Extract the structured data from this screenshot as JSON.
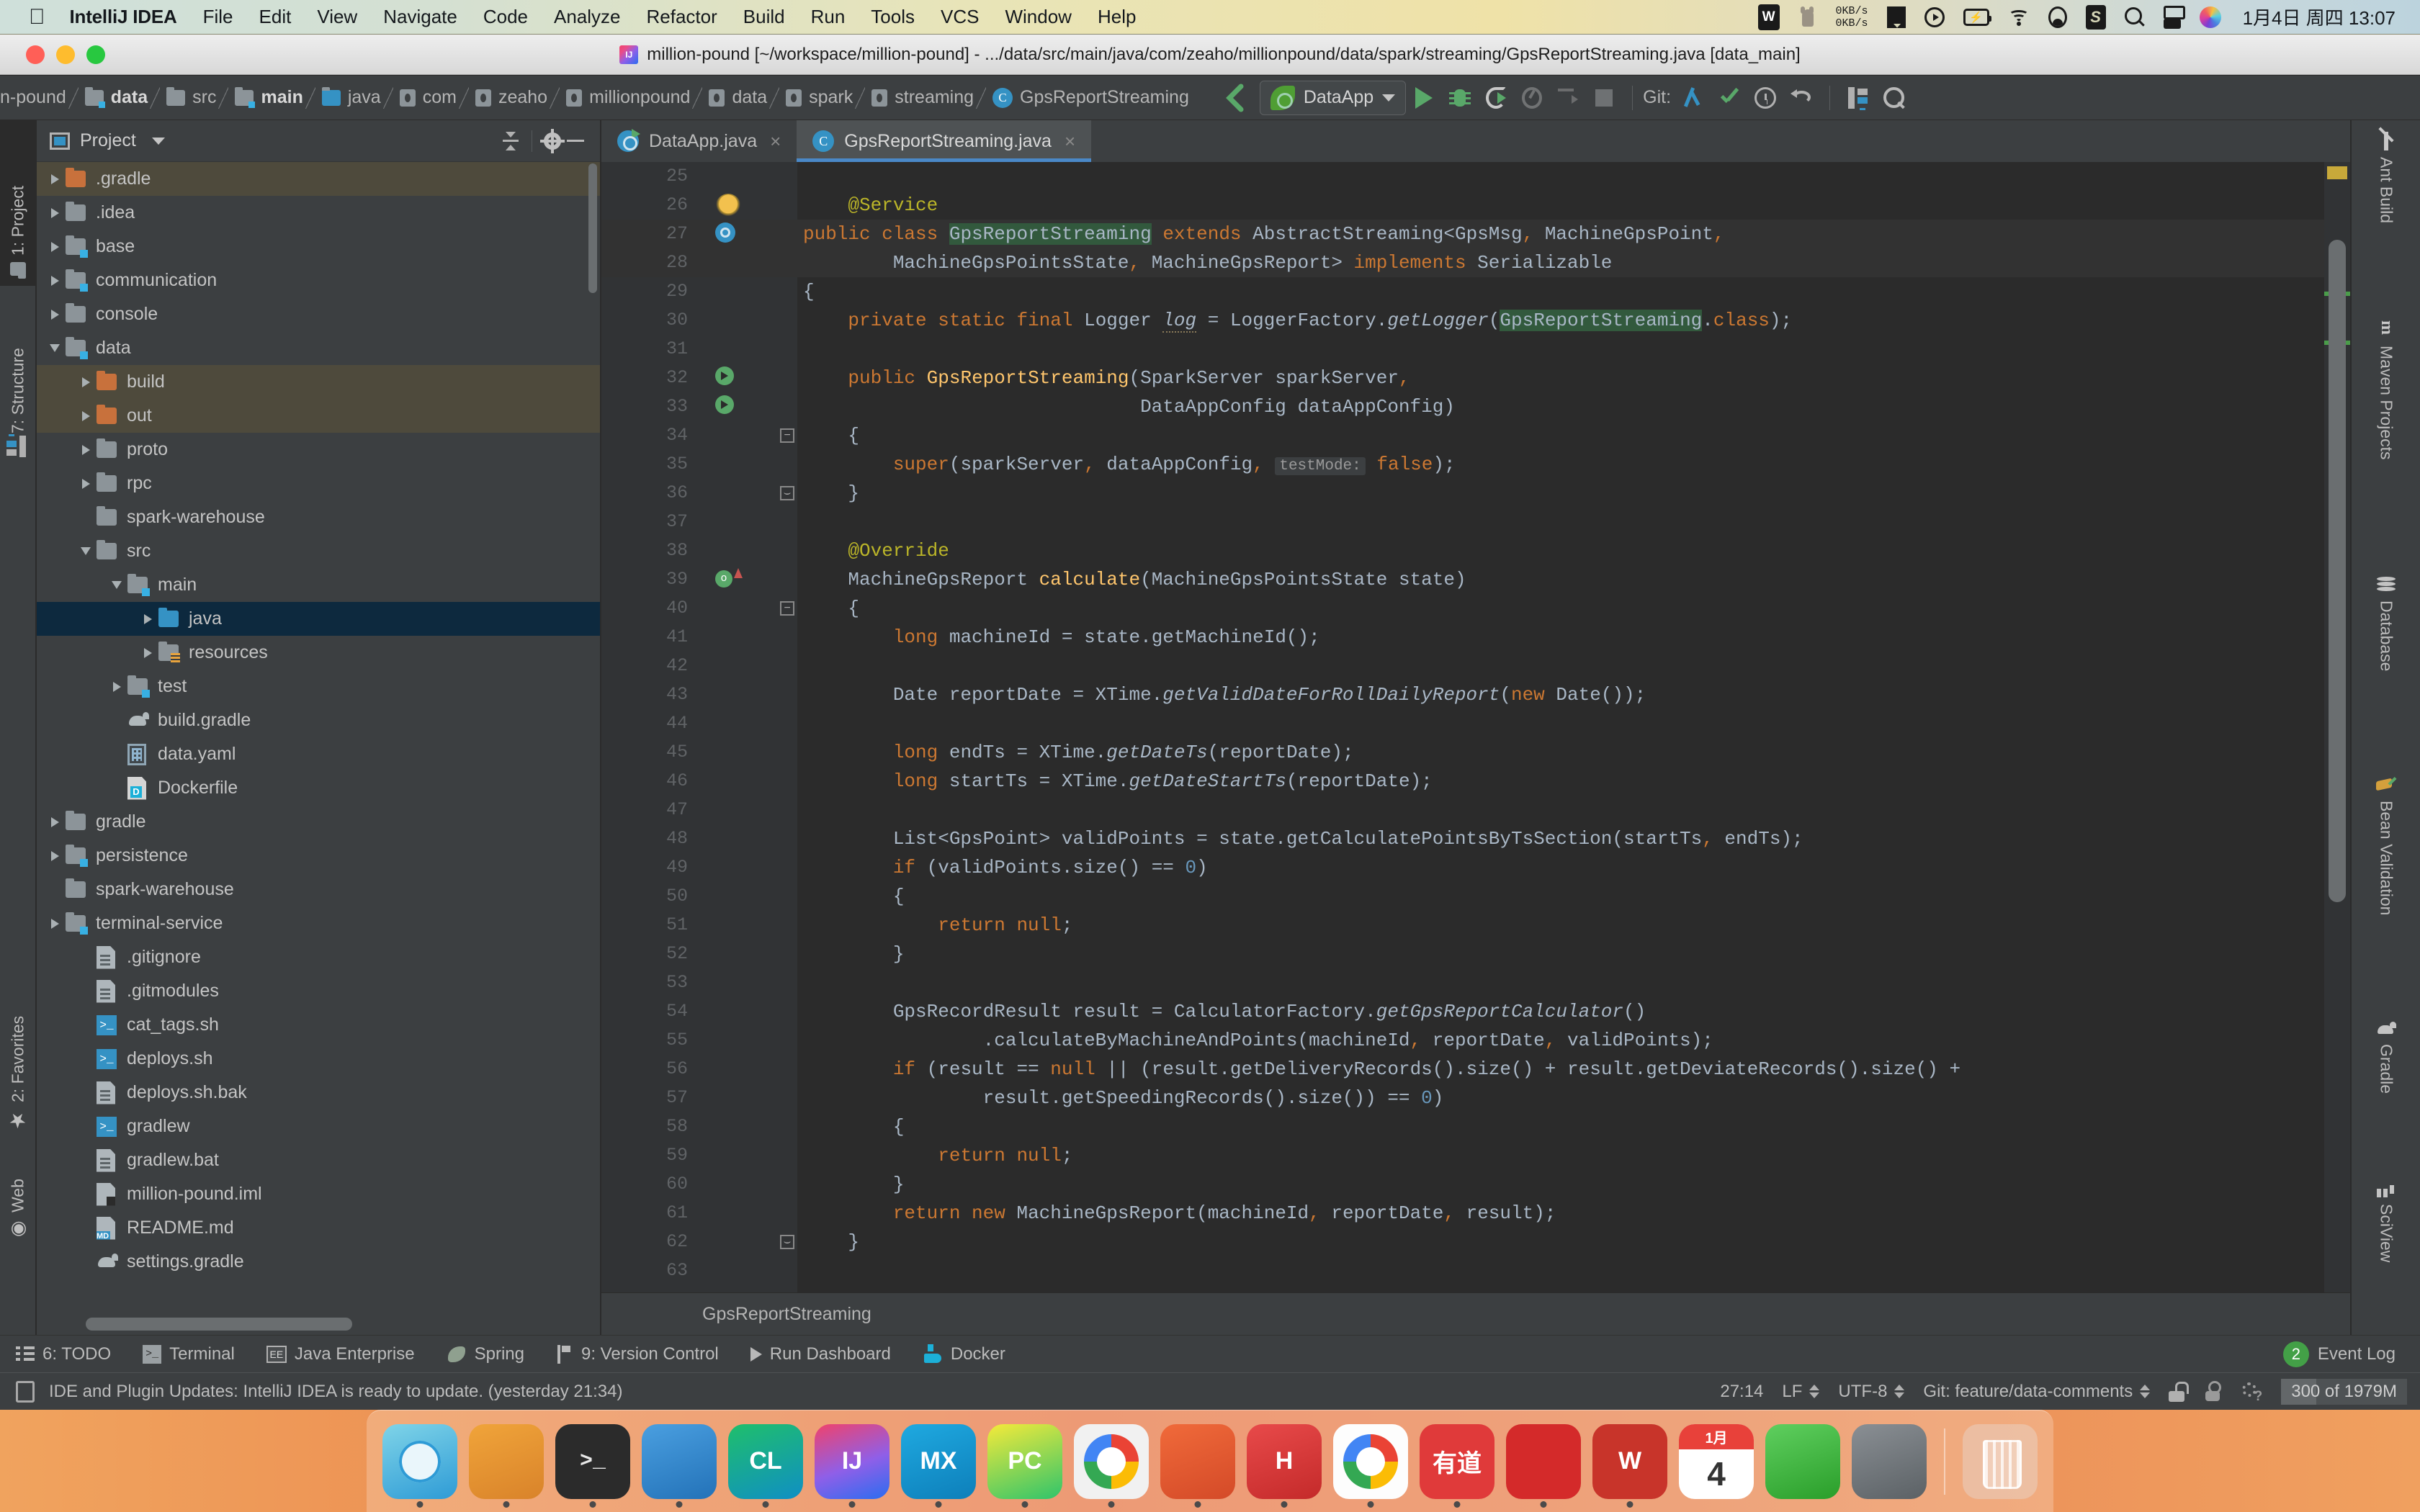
{
  "macos": {
    "apple_logo": "apple-logo",
    "app_name": "IntelliJ IDEA",
    "menus": [
      "File",
      "Edit",
      "View",
      "Navigate",
      "Code",
      "Analyze",
      "Refactor",
      "Build",
      "Run",
      "Tools",
      "VCS",
      "Window",
      "Help"
    ],
    "tray": {
      "net_up": "0KB/s",
      "net_down": "0KB/s",
      "battery_glyph": "⚡",
      "icons": [
        "wps-icon",
        "cat-icon",
        "network-speed-icon",
        "book-icon",
        "play-circle-icon",
        "battery-icon",
        "wifi-icon",
        "user-account-icon",
        "sogou-input-icon",
        "spotlight-search-icon",
        "control-center-icon",
        "siri-icon"
      ],
      "clock": "1月4日 周四  13:07"
    }
  },
  "window": {
    "title": "million-pound [~/workspace/million-pound] - .../data/src/main/java/com/zeaho/millionpound/data/spark/streaming/GpsReportStreaming.java [data_main]",
    "traffic_lights": [
      "close",
      "minimize",
      "maximize"
    ]
  },
  "navbar": {
    "crumbs": [
      {
        "label": "n-pound",
        "icon": "folder-icon",
        "kind": "plain"
      },
      {
        "label": "data",
        "icon": "module-folder-icon",
        "kind": "module",
        "active": true
      },
      {
        "label": "src",
        "icon": "folder-icon",
        "kind": "plain"
      },
      {
        "label": "main",
        "icon": "module-folder-icon",
        "kind": "module",
        "active": true
      },
      {
        "label": "java",
        "icon": "source-folder-icon",
        "kind": "source"
      },
      {
        "label": "com",
        "icon": "package-icon",
        "kind": "package"
      },
      {
        "label": "zeaho",
        "icon": "package-icon",
        "kind": "package"
      },
      {
        "label": "millionpound",
        "icon": "package-icon",
        "kind": "package"
      },
      {
        "label": "data",
        "icon": "package-icon",
        "kind": "package"
      },
      {
        "label": "spark",
        "icon": "package-icon",
        "kind": "package"
      },
      {
        "label": "streaming",
        "icon": "package-icon",
        "kind": "package"
      },
      {
        "label": "GpsReportStreaming",
        "icon": "class-icon",
        "kind": "class"
      }
    ],
    "back_label": "back-arrow-icon",
    "run_config": "DataApp",
    "toolbar_icons": [
      "run-icon",
      "debug-icon",
      "run-with-coverage-icon",
      "profile-icon",
      "run-steps-icon",
      "stop-icon"
    ],
    "git_label": "Git:",
    "git_icons": [
      "update-project-icon",
      "commit-icon",
      "history-icon",
      "rollback-icon",
      "structure-icon",
      "search-everywhere-icon"
    ]
  },
  "left_strip": {
    "tabs": [
      {
        "label": "1: Project",
        "icon": "project-folder-icon",
        "selected": true
      },
      {
        "label": "7: Structure",
        "icon": "structure-icon",
        "selected": false
      },
      {
        "label": "2: Favorites",
        "icon": "star-icon",
        "selected": false
      },
      {
        "label": "Web",
        "icon": "web-icon",
        "selected": false
      }
    ]
  },
  "right_strip": {
    "tabs": [
      {
        "label": "Ant Build",
        "icon": "ant-icon"
      },
      {
        "label": "Maven Projects",
        "icon": "maven-icon"
      },
      {
        "label": "Database",
        "icon": "database-icon"
      },
      {
        "label": "Bean Validation",
        "icon": "bean-validation-icon"
      },
      {
        "label": "Gradle",
        "icon": "gradle-elephant-icon"
      },
      {
        "label": "SciView",
        "icon": "sciview-icon"
      }
    ]
  },
  "project_panel": {
    "title": "Project",
    "header_icons": [
      "collapse-all-icon",
      "gear-icon",
      "minimize-icon"
    ],
    "tree": [
      {
        "label": ".gradle",
        "indent": 1,
        "arrow": "closed",
        "icon": "folder-orange-icon",
        "state": "hl"
      },
      {
        "label": ".idea",
        "indent": 1,
        "arrow": "closed",
        "icon": "folder-gray-icon",
        "state": ""
      },
      {
        "label": "base",
        "indent": 1,
        "arrow": "closed",
        "icon": "folder-module-icon",
        "state": ""
      },
      {
        "label": "communication",
        "indent": 1,
        "arrow": "closed",
        "icon": "folder-module-icon",
        "state": ""
      },
      {
        "label": "console",
        "indent": 1,
        "arrow": "closed",
        "icon": "folder-gray-icon",
        "state": ""
      },
      {
        "label": "data",
        "indent": 1,
        "arrow": "open",
        "icon": "folder-module-icon",
        "state": ""
      },
      {
        "label": "build",
        "indent": 2,
        "arrow": "closed",
        "icon": "folder-orange-icon",
        "state": "hl"
      },
      {
        "label": "out",
        "indent": 2,
        "arrow": "closed",
        "icon": "folder-orange-icon",
        "state": "hl"
      },
      {
        "label": "proto",
        "indent": 2,
        "arrow": "closed",
        "icon": "folder-gray-icon",
        "state": ""
      },
      {
        "label": "rpc",
        "indent": 2,
        "arrow": "closed",
        "icon": "folder-gray-icon",
        "state": ""
      },
      {
        "label": "spark-warehouse",
        "indent": 2,
        "arrow": "none",
        "icon": "folder-gray-icon",
        "state": ""
      },
      {
        "label": "src",
        "indent": 2,
        "arrow": "open",
        "icon": "folder-gray-icon",
        "state": ""
      },
      {
        "label": "main",
        "indent": 3,
        "arrow": "open",
        "icon": "folder-module-icon",
        "state": ""
      },
      {
        "label": "java",
        "indent": 4,
        "arrow": "closed",
        "icon": "folder-source-icon",
        "state": "sel"
      },
      {
        "label": "resources",
        "indent": 4,
        "arrow": "closed",
        "icon": "folder-resources-icon",
        "state": ""
      },
      {
        "label": "test",
        "indent": 3,
        "arrow": "closed",
        "icon": "folder-module-icon",
        "state": ""
      },
      {
        "label": "build.gradle",
        "indent": 3,
        "arrow": "none",
        "icon": "gradle-file-icon",
        "state": ""
      },
      {
        "label": "data.yaml",
        "indent": 3,
        "arrow": "none",
        "icon": "yaml-file-icon",
        "state": ""
      },
      {
        "label": "Dockerfile",
        "indent": 3,
        "arrow": "none",
        "icon": "dockerfile-icon",
        "state": ""
      },
      {
        "label": "gradle",
        "indent": 1,
        "arrow": "closed",
        "icon": "folder-gray-icon",
        "state": ""
      },
      {
        "label": "persistence",
        "indent": 1,
        "arrow": "closed",
        "icon": "folder-module-icon",
        "state": ""
      },
      {
        "label": "spark-warehouse",
        "indent": 1,
        "arrow": "none",
        "icon": "folder-gray-icon",
        "state": ""
      },
      {
        "label": "terminal-service",
        "indent": 1,
        "arrow": "closed",
        "icon": "folder-module-icon",
        "state": ""
      },
      {
        "label": ".gitignore",
        "indent": 2,
        "arrow": "none",
        "icon": "text-file-icon",
        "state": ""
      },
      {
        "label": ".gitmodules",
        "indent": 2,
        "arrow": "none",
        "icon": "text-file-icon",
        "state": ""
      },
      {
        "label": "cat_tags.sh",
        "indent": 2,
        "arrow": "none",
        "icon": "shell-file-icon",
        "state": ""
      },
      {
        "label": "deploys.sh",
        "indent": 2,
        "arrow": "none",
        "icon": "shell-file-icon",
        "state": ""
      },
      {
        "label": "deploys.sh.bak",
        "indent": 2,
        "arrow": "none",
        "icon": "text-file-icon",
        "state": ""
      },
      {
        "label": "gradlew",
        "indent": 2,
        "arrow": "none",
        "icon": "shell-file-icon",
        "state": ""
      },
      {
        "label": "gradlew.bat",
        "indent": 2,
        "arrow": "none",
        "icon": "text-file-icon",
        "state": ""
      },
      {
        "label": "million-pound.iml",
        "indent": 2,
        "arrow": "none",
        "icon": "iml-file-icon",
        "state": ""
      },
      {
        "label": "README.md",
        "indent": 2,
        "arrow": "none",
        "icon": "markdown-file-icon",
        "state": ""
      },
      {
        "label": "settings.gradle",
        "indent": 2,
        "arrow": "none",
        "icon": "gradle-file-icon",
        "state": ""
      }
    ]
  },
  "editor": {
    "tabs": [
      {
        "label": "DataApp.java",
        "icon": "spring-class-icon",
        "active": false,
        "close": "×"
      },
      {
        "label": "GpsReportStreaming.java",
        "icon": "class-icon",
        "active": true,
        "close": "×"
      }
    ],
    "breadcrumb": "GpsReportStreaming",
    "first_line": 25,
    "lines": [
      {
        "n": 25,
        "html": ""
      },
      {
        "n": 26,
        "html": "    <span class=\"an\">@Service</span>",
        "marker": "bulb"
      },
      {
        "n": 27,
        "html": "<span class=\"kw\">public class</span> <span class=\"hl-use\">GpsReportStreaming</span> <span class=\"kw\">extends</span> AbstractStreaming&lt;GpsMsg<span class=\"kw\">,</span> MachineGpsPoint<span class=\"kw\">,</span>",
        "marker": "spring",
        "hl": true
      },
      {
        "n": 28,
        "html": "        MachineGpsPointsState<span class=\"kw\">,</span> MachineGpsReport&gt; <span class=\"kw\">implements</span> Serializable",
        "hl": true
      },
      {
        "n": 29,
        "html": "{"
      },
      {
        "n": 30,
        "html": "    <span class=\"kw\">private static final</span> Logger <span class=\"logv\">log</span> = LoggerFactory.<span class=\"ital\">getLogger</span>(<span class=\"hl-use\">GpsReportStreaming</span>.<span class=\"kw\">class</span>);"
      },
      {
        "n": 31,
        "html": ""
      },
      {
        "n": 32,
        "html": "    <span class=\"kw\">public</span> <span class=\"mth\">GpsReportStreaming</span>(SparkServer sparkServer<span class=\"kw\">,</span>",
        "marker": "greenarrow"
      },
      {
        "n": 33,
        "html": "                              DataAppConfig dataAppConfig)",
        "marker": "greenarrow"
      },
      {
        "n": 34,
        "html": "    {",
        "fold": "open"
      },
      {
        "n": 35,
        "html": "        <span class=\"kw\">super</span>(sparkServer<span class=\"kw\">,</span> dataAppConfig<span class=\"kw\">,</span> <span class=\"hint\">testMode:</span> <span class=\"kw\">false</span>);"
      },
      {
        "n": 36,
        "html": "    }",
        "fold": "close"
      },
      {
        "n": 37,
        "html": ""
      },
      {
        "n": 38,
        "html": "    <span class=\"an\">@Override</span>"
      },
      {
        "n": 39,
        "html": "    MachineGpsReport <span class=\"mth\">calculate</span>(MachineGpsPointsState state)",
        "marker": "override"
      },
      {
        "n": 40,
        "html": "    {",
        "fold": "open"
      },
      {
        "n": 41,
        "html": "        <span class=\"kw\">long</span> machineId = state.getMachineId();"
      },
      {
        "n": 42,
        "html": ""
      },
      {
        "n": 43,
        "html": "        Date reportDate = XTime.<span class=\"ital\">getValidDateForRollDailyReport</span>(<span class=\"kw\">new</span> Date());"
      },
      {
        "n": 44,
        "html": ""
      },
      {
        "n": 45,
        "html": "        <span class=\"kw\">long</span> endTs = XTime.<span class=\"ital\">getDateTs</span>(reportDate);"
      },
      {
        "n": 46,
        "html": "        <span class=\"kw\">long</span> startTs = XTime.<span class=\"ital\">getDateStartTs</span>(reportDate);"
      },
      {
        "n": 47,
        "html": ""
      },
      {
        "n": 48,
        "html": "        List&lt;GpsPoint&gt; validPoints = state.getCalculatePointsByTsSection(startTs<span class=\"kw\">,</span> endTs);"
      },
      {
        "n": 49,
        "html": "        <span class=\"kw\">if</span> (validPoints.size() == <span class=\"num\">0</span>)"
      },
      {
        "n": 50,
        "html": "        {"
      },
      {
        "n": 51,
        "html": "            <span class=\"kw\">return null</span>;"
      },
      {
        "n": 52,
        "html": "        }"
      },
      {
        "n": 53,
        "html": ""
      },
      {
        "n": 54,
        "html": "        GpsRecordResult result = CalculatorFactory.<span class=\"ital\">getGpsReportCalculator</span>()"
      },
      {
        "n": 55,
        "html": "                .calculateByMachineAndPoints(machineId<span class=\"kw\">,</span> reportDate<span class=\"kw\">,</span> validPoints);"
      },
      {
        "n": 56,
        "html": "        <span class=\"kw\">if</span> (result == <span class=\"kw\">null</span> || (result.getDeliveryRecords().size() + result.getDeviateRecords().size() +"
      },
      {
        "n": 57,
        "html": "                result.getSpeedingRecords().size()) == <span class=\"num\">0</span>)"
      },
      {
        "n": 58,
        "html": "        {"
      },
      {
        "n": 59,
        "html": "            <span class=\"kw\">return null</span>;"
      },
      {
        "n": 60,
        "html": "        }"
      },
      {
        "n": 61,
        "html": "        <span class=\"kw\">return new</span> MachineGpsReport(machineId<span class=\"kw\">,</span> reportDate<span class=\"kw\">,</span> result);"
      },
      {
        "n": 62,
        "html": "    }",
        "fold": "close"
      },
      {
        "n": 63,
        "html": ""
      }
    ]
  },
  "toolwindow_bar": {
    "items": [
      {
        "label": "6: TODO",
        "icon": "todo-icon",
        "underline_char": "6"
      },
      {
        "label": "Terminal",
        "icon": "terminal-icon"
      },
      {
        "label": "Java Enterprise",
        "icon": "java-enterprise-icon"
      },
      {
        "label": "Spring",
        "icon": "spring-leaf-icon"
      },
      {
        "label": "9: Version Control",
        "icon": "version-control-icon",
        "underline_char": "9"
      },
      {
        "label": "Run Dashboard",
        "icon": "run-dashboard-icon"
      },
      {
        "label": "Docker",
        "icon": "docker-whale-icon"
      }
    ],
    "event_log": {
      "label": "Event Log",
      "badge": "2"
    }
  },
  "statusbar": {
    "message": "IDE and Plugin Updates: IntelliJ IDEA is ready to update. (yesterday 21:34)",
    "message_icon": "notification-icon",
    "caret": "27:14",
    "line_sep": "LF",
    "encoding": "UTF-8",
    "git_branch": "Git: feature/data-comments",
    "icons": [
      "lock-icon",
      "inspection-icon",
      "inspection-profile-icon"
    ],
    "memory": "300 of 1979M"
  },
  "dock": {
    "items": [
      {
        "name": "finder",
        "label": "",
        "cls": "d-finder",
        "running": true
      },
      {
        "name": "sublime-text",
        "label": "",
        "cls": "d-sublime",
        "running": true
      },
      {
        "name": "terminal",
        "label": "",
        "cls": "d-term",
        "running": true
      },
      {
        "name": "visual-studio-code",
        "label": "",
        "cls": "d-vscode",
        "running": true
      },
      {
        "name": "clion",
        "label": "CL",
        "cls": "d-clion",
        "running": true
      },
      {
        "name": "intellij-idea",
        "label": "IJ",
        "cls": "d-idea",
        "running": true
      },
      {
        "name": "mindmaster",
        "label": "MX",
        "cls": "d-mx",
        "running": true
      },
      {
        "name": "pycharm",
        "label": "PC",
        "cls": "d-pycharm",
        "running": true
      },
      {
        "name": "chromium",
        "label": "",
        "cls": "d-chrome2",
        "running": true
      },
      {
        "name": "sketch-pen",
        "label": "",
        "cls": "d-pen",
        "running": true
      },
      {
        "name": "hbuilder",
        "label": "H",
        "cls": "d-h",
        "running": true
      },
      {
        "name": "google-chrome",
        "label": "",
        "cls": "d-chrome",
        "running": true
      },
      {
        "name": "youdao-dict",
        "label": "有道",
        "cls": "d-youdao",
        "running": true
      },
      {
        "name": "netease-music",
        "label": "",
        "cls": "d-neteasy",
        "running": true
      },
      {
        "name": "wps-office",
        "label": "W",
        "cls": "d-wps",
        "running": true
      },
      {
        "name": "calendar",
        "label": "",
        "cls": "d-cal",
        "running": false,
        "cal_month": "1月",
        "cal_day": "4"
      },
      {
        "name": "app-store",
        "label": "",
        "cls": "d-store",
        "running": false
      },
      {
        "name": "system-preferences",
        "label": "",
        "cls": "d-prefs",
        "running": false
      }
    ],
    "trash": {
      "name": "trash",
      "cls": "d-trash"
    }
  }
}
